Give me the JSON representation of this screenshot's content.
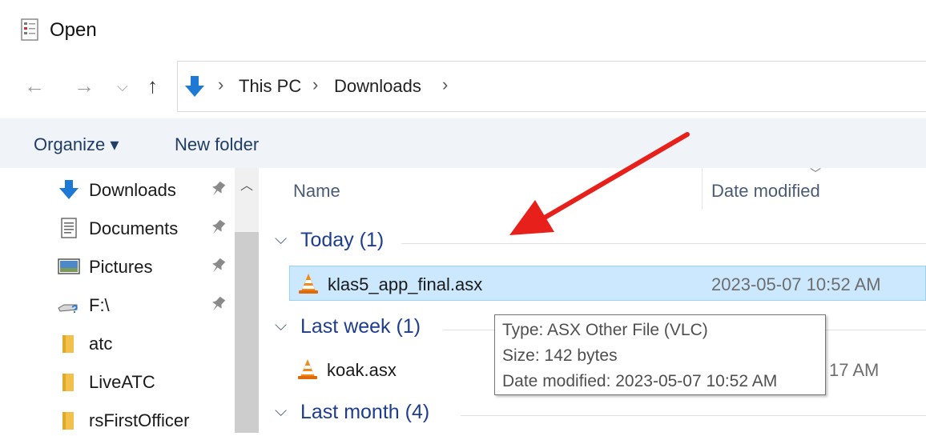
{
  "window": {
    "title": "Open"
  },
  "nav": {
    "back": "←",
    "forward": "→",
    "recent": "⌵",
    "up": "↑",
    "breadcrumb": [
      "This PC",
      "Downloads"
    ]
  },
  "commandbar": {
    "organize": "Organize ▾",
    "new_folder": "New folder"
  },
  "sidebar": {
    "items": [
      {
        "label": "Downloads",
        "icon": "download-arrow-icon",
        "pinned": true
      },
      {
        "label": "Documents",
        "icon": "document-icon",
        "pinned": true
      },
      {
        "label": "Pictures",
        "icon": "pictures-icon",
        "pinned": true
      },
      {
        "label": "F:\\",
        "icon": "drive-icon",
        "pinned": true
      },
      {
        "label": "atc",
        "icon": "folder-icon",
        "pinned": false
      },
      {
        "label": "LiveATC",
        "icon": "folder-icon",
        "pinned": false
      },
      {
        "label": "rsFirstOfficer",
        "icon": "folder-icon",
        "pinned": false
      }
    ]
  },
  "filelist": {
    "columns": {
      "name": "Name",
      "date": "Date modified"
    },
    "groups": [
      {
        "label": "Today (1)",
        "files": [
          {
            "name": "klas5_app_final.asx",
            "date": "2023-05-07 10:52 AM",
            "selected": true
          }
        ]
      },
      {
        "label": "Last week (1)",
        "files": [
          {
            "name": "koak.asx",
            "date": "17 AM",
            "selected": false
          }
        ]
      },
      {
        "label": "Last month (4)",
        "files": []
      }
    ]
  },
  "tooltip": {
    "type": "Type: ASX Other File (VLC)",
    "size": "Size: 142 bytes",
    "modified": "Date modified: 2023-05-07 10:52 AM"
  },
  "colors": {
    "accent_folder": "#f3c14a",
    "download_blue": "#1e78d6",
    "selection": "#cce8ff",
    "annotation_arrow": "#e8201c",
    "group_header": "#1e3d8f"
  }
}
